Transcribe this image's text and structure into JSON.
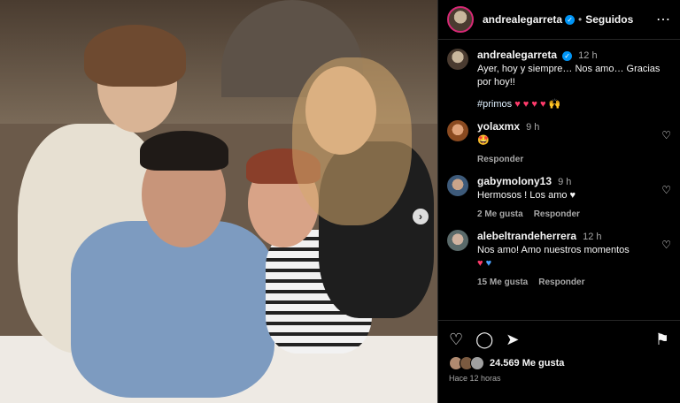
{
  "header": {
    "username": "andrealegarreta",
    "dot": "•",
    "follow_status": "Seguidos",
    "more": "⋯"
  },
  "caption": {
    "username": "andrealegarreta",
    "time": "12 h",
    "text1": "Ayer, hoy y siempre… Nos amo… Gracias por hoy!!",
    "hashtag": "#primos",
    "hearts": "♥ ♥ ♥ ♥",
    "hands": "🙌"
  },
  "comments": [
    {
      "username": "yolaxmx",
      "time": "9 h",
      "text": "🤩",
      "reply": "Responder",
      "likes": ""
    },
    {
      "username": "gabymolony13",
      "time": "9 h",
      "text": "Hermosos ! Los amo ♥",
      "likes": "2 Me gusta",
      "reply": "Responder"
    },
    {
      "username": "alebeltrandeherrera",
      "time": "12 h",
      "text": "Nos amo! Amo nuestros momentos",
      "hearts_pink": "♥",
      "hearts_blue": "♥",
      "likes": "15 Me gusta",
      "reply": "Responder"
    }
  ],
  "footer": {
    "likes": "24.569 Me gusta",
    "time_ago": "Hace 12 horas"
  },
  "icons": {
    "like": "heart-icon",
    "comment": "comment-icon",
    "share": "share-icon",
    "save": "bookmark-icon",
    "next": "chevron-right-icon"
  },
  "colors": {
    "accent_blue": "#0095f6",
    "heart_pink": "#ff3b6b"
  }
}
